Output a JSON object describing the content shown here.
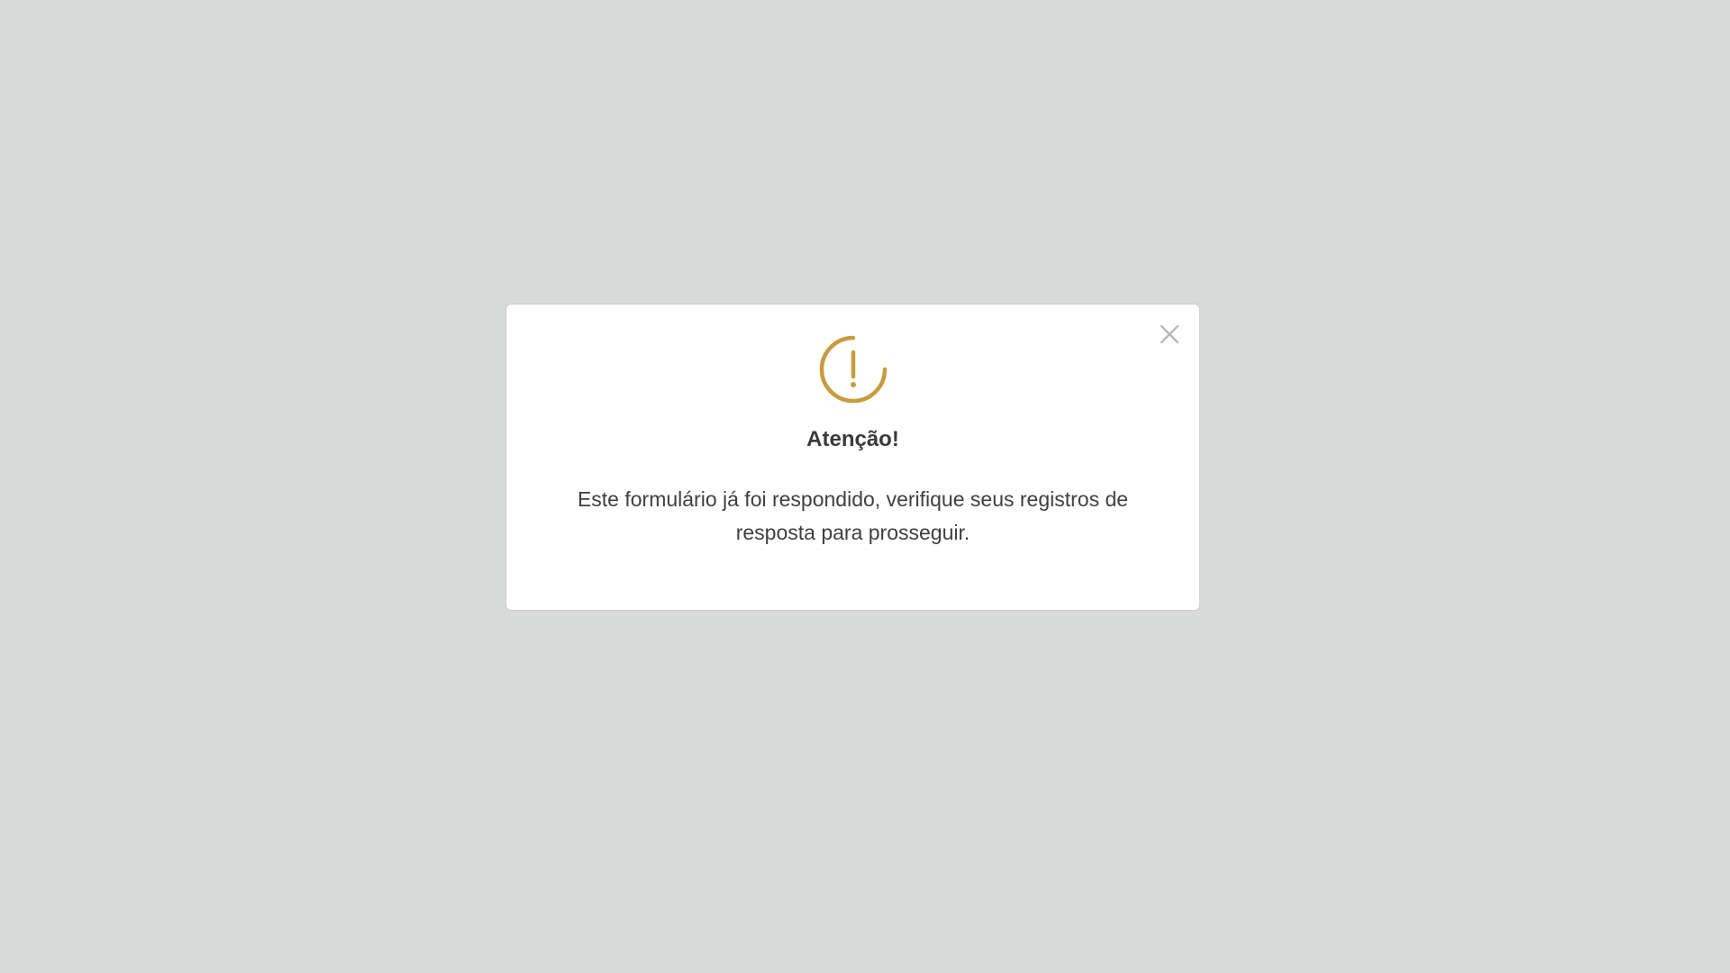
{
  "modal": {
    "title": "Atenção!",
    "message": "Este formulário já foi respondido, verifique seus registros de resposta para prosseguir.",
    "icon": "warning-exclamation-icon",
    "close_icon": "close-icon"
  },
  "colors": {
    "background": "#d9dbda",
    "modal_bg": "#ffffff",
    "accent": "#c99b3e",
    "close": "#b8b8b8",
    "text": "#3a3a3a"
  }
}
